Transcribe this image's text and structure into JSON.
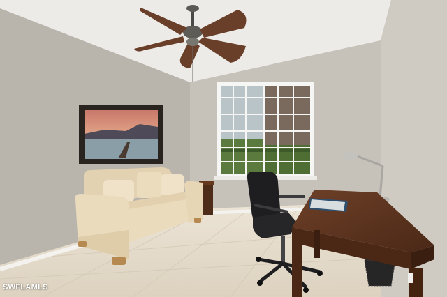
{
  "photo": {
    "watermark": "SWFLAMLS",
    "colors": {
      "ceiling": "#ecebe8",
      "wall_left": "#b9b4ac",
      "wall_back": "#c6c1b9",
      "wall_right": "#cfcac2",
      "floor": "#e6dccc",
      "baseboard": "#f4f2ee",
      "sofa": "#eadbbd",
      "desk": "#5c3420",
      "chair": "#1e1e20",
      "fan_blade": "#6a3f2a",
      "window_frame": "#f6f6f4"
    }
  }
}
